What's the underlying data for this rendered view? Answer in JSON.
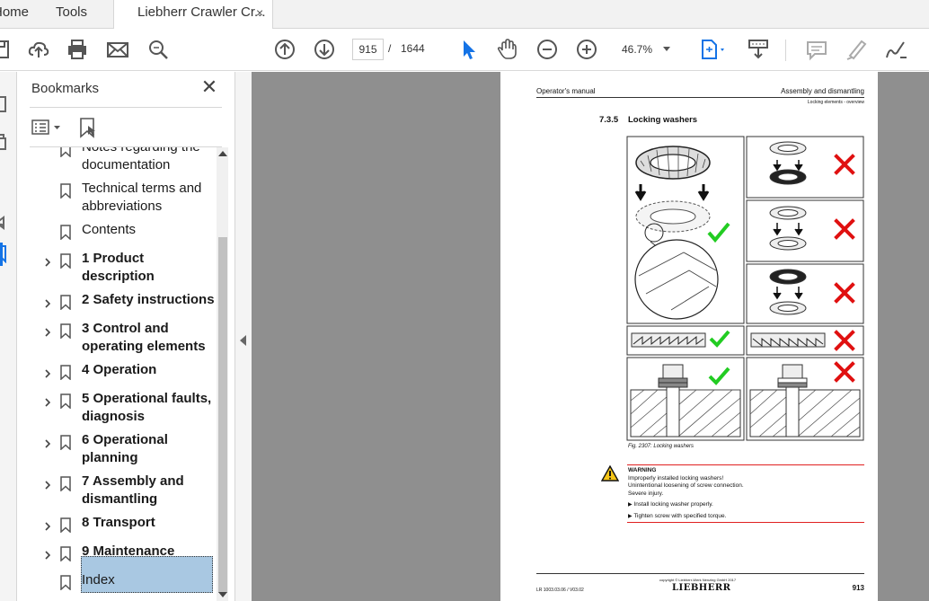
{
  "tabs": {
    "home": "Home",
    "tools": "Tools",
    "document": "Liebherr Crawler Cr...",
    "close_glyph": "×"
  },
  "toolbar": {
    "current_page": "915",
    "page_separator": "/",
    "total_pages": "1644",
    "zoom": "46.7%",
    "icons": [
      "save-icon",
      "upload-icon",
      "print-icon",
      "email-icon",
      "search-icon",
      "page-up-icon",
      "page-down-icon",
      "select-cursor-icon",
      "hand-icon",
      "zoom-out-icon",
      "zoom-in-icon",
      "fit-page-icon",
      "scroll-mode-icon",
      "comment-icon",
      "highlight-icon",
      "sign-icon"
    ]
  },
  "bookmarks": {
    "title": "Bookmarks",
    "close_glyph": "✕",
    "items": [
      {
        "line1": "Notes regarding the",
        "line2": "documentation",
        "bold": false,
        "expandable": false
      },
      {
        "line1": "Technical terms and",
        "line2": "abbreviations",
        "bold": false,
        "expandable": false
      },
      {
        "line1": "Contents",
        "line2": "",
        "bold": false,
        "expandable": false
      },
      {
        "line1": "1 Product",
        "line2": "description",
        "bold": true,
        "expandable": true
      },
      {
        "line1": "2 Safety instructions",
        "line2": "",
        "bold": true,
        "expandable": true
      },
      {
        "line1": "3 Control and",
        "line2": "operating elements",
        "bold": true,
        "expandable": true
      },
      {
        "line1": "4 Operation",
        "line2": "",
        "bold": true,
        "expandable": true
      },
      {
        "line1": "5 Operational faults,",
        "line2": "diagnosis",
        "bold": true,
        "expandable": true
      },
      {
        "line1": "6 Operational",
        "line2": "planning",
        "bold": true,
        "expandable": true
      },
      {
        "line1": "7 Assembly and",
        "line2": "dismantling",
        "bold": true,
        "expandable": true,
        "selected": true
      },
      {
        "line1": "8 Transport",
        "line2": "",
        "bold": true,
        "expandable": true
      },
      {
        "line1": "9 Maintenance",
        "line2": "",
        "bold": true,
        "expandable": true
      },
      {
        "line1": "Index",
        "line2": "",
        "bold": false,
        "expandable": false
      }
    ]
  },
  "pdf": {
    "header_left": "Operator's manual",
    "header_right": "Assembly and dismantling",
    "header_sub": "Locking elements - overview",
    "section_number": "7.3.5",
    "section_title": "Locking washers",
    "figure_caption": "Fig. 2307: Locking washers",
    "warning_title": "WARNING",
    "warning_lines": [
      "Improperly installed locking washers!",
      "Unintentional loosening of screw connection.",
      "Severe injury."
    ],
    "warning_actions": [
      "Install locking washer properly.",
      "Tighten screw with specified torque."
    ],
    "footer_copyright": "copyright © Liebherr-Werk Nenzing GmbH 2017",
    "footer_doc": "LR 1003.03.06 / V03.02",
    "footer_brand": "LIEBHERR",
    "footer_page": "913"
  },
  "colors": {
    "accent": "#1473e6",
    "selection": "#a9c8e2",
    "check": "#22cc22",
    "cross": "#e01010",
    "warning_rule": "#e02020",
    "doc_bg": "#8f8f8f"
  }
}
